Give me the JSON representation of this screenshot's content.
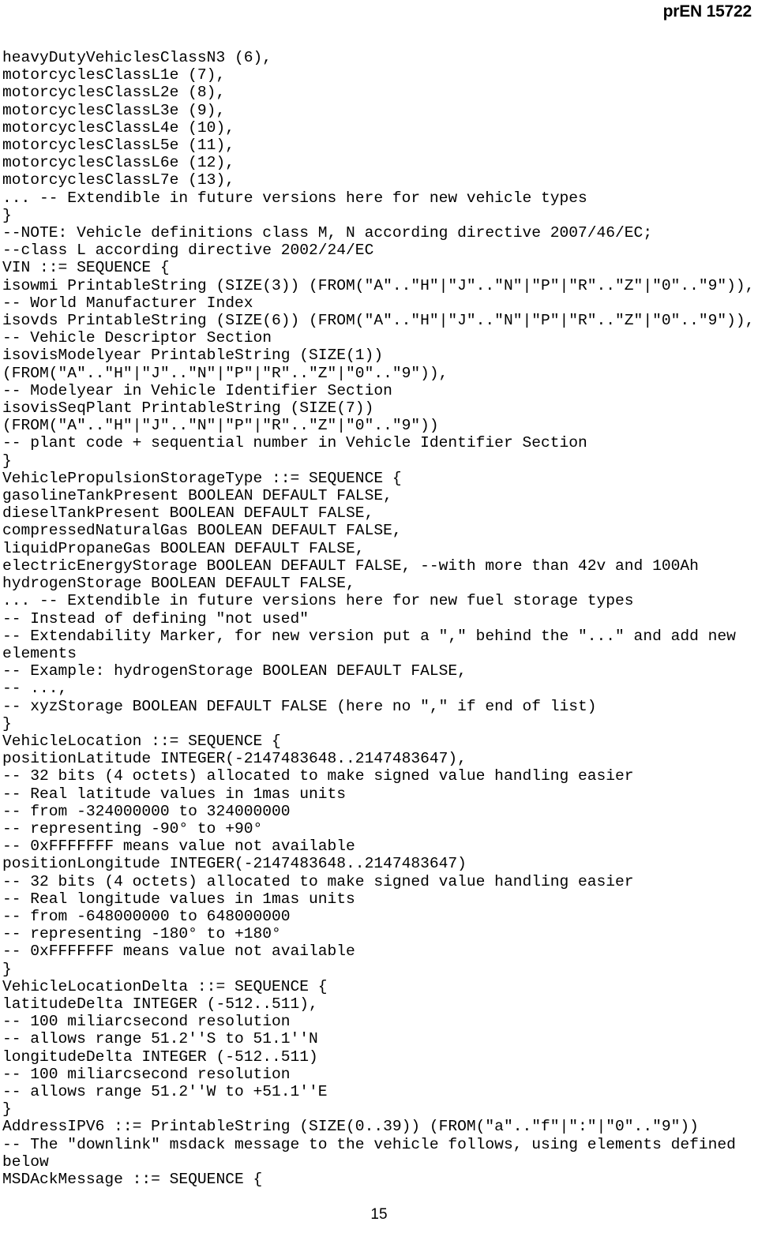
{
  "header": {
    "standard_ref": "prEN 15722"
  },
  "footer": {
    "page_number": "15"
  },
  "code": {
    "language": "ASN.1",
    "lines": [
      "heavyDutyVehiclesClassN3 (6),",
      "motorcyclesClassL1e (7),",
      "motorcyclesClassL2e (8),",
      "motorcyclesClassL3e (9),",
      "motorcyclesClassL4e (10),",
      "motorcyclesClassL5e (11),",
      "motorcyclesClassL6e (12),",
      "motorcyclesClassL7e (13),",
      "... -- Extendible in future versions here for new vehicle types",
      "}",
      "--NOTE: Vehicle definitions class M, N according directive 2007/46/EC;",
      "--class L according directive 2002/24/EC",
      "VIN ::= SEQUENCE {",
      "isowmi PrintableString (SIZE(3)) (FROM(\"A\"..\"H\"|\"J\"..\"N\"|\"P\"|\"R\"..\"Z\"|\"0\"..\"9\")),",
      "-- World Manufacturer Index",
      "isovds PrintableString (SIZE(6)) (FROM(\"A\"..\"H\"|\"J\"..\"N\"|\"P\"|\"R\"..\"Z\"|\"0\"..\"9\")),",
      "-- Vehicle Descriptor Section",
      "isovisModelyear PrintableString (SIZE(1))",
      "(FROM(\"A\"..\"H\"|\"J\"..\"N\"|\"P\"|\"R\"..\"Z\"|\"0\"..\"9\")),",
      "-- Modelyear in Vehicle Identifier Section",
      "isovisSeqPlant PrintableString (SIZE(7))",
      "(FROM(\"A\"..\"H\"|\"J\"..\"N\"|\"P\"|\"R\"..\"Z\"|\"0\"..\"9\"))",
      "-- plant code + sequential number in Vehicle Identifier Section",
      "}",
      "VehiclePropulsionStorageType ::= SEQUENCE {",
      "gasolineTankPresent BOOLEAN DEFAULT FALSE,",
      "dieselTankPresent BOOLEAN DEFAULT FALSE,",
      "compressedNaturalGas BOOLEAN DEFAULT FALSE,",
      "liquidPropaneGas BOOLEAN DEFAULT FALSE,",
      "electricEnergyStorage BOOLEAN DEFAULT FALSE, --with more than 42v and 100Ah",
      "hydrogenStorage BOOLEAN DEFAULT FALSE,",
      "... -- Extendible in future versions here for new fuel storage types",
      "-- Instead of defining \"not used\"",
      "-- Extendability Marker, for new version put a \",\" behind the \"...\" and add new",
      "elements",
      "-- Example: hydrogenStorage BOOLEAN DEFAULT FALSE,",
      "-- ...,",
      "-- xyzStorage BOOLEAN DEFAULT FALSE (here no \",\" if end of list)",
      "}",
      "VehicleLocation ::= SEQUENCE {",
      "positionLatitude INTEGER(-2147483648..2147483647),",
      "-- 32 bits (4 octets) allocated to make signed value handling easier",
      "-- Real latitude values in 1mas units",
      "-- from -324000000 to 324000000",
      "-- representing -90° to +90°",
      "-- 0xFFFFFFF means value not available",
      "positionLongitude INTEGER(-2147483648..2147483647)",
      "-- 32 bits (4 octets) allocated to make signed value handling easier",
      "-- Real longitude values in 1mas units",
      "-- from -648000000 to 648000000",
      "-- representing -180° to +180°",
      "-- 0xFFFFFFF means value not available",
      "}",
      "VehicleLocationDelta ::= SEQUENCE {",
      "latitudeDelta INTEGER (-512..511),",
      "-- 100 miliarcsecond resolution",
      "-- allows range 51.2''S to 51.1''N",
      "longitudeDelta INTEGER (-512..511)",
      "-- 100 miliarcsecond resolution",
      "-- allows range 51.2''W to +51.1''E",
      "}",
      "AddressIPV6 ::= PrintableString (SIZE(0..39)) (FROM(\"a\"..\"f\"|\":\"|\"0\"..\"9\"))",
      "-- The \"downlink\" msdack message to the vehicle follows, using elements defined",
      "below",
      "MSDAckMessage ::= SEQUENCE {"
    ]
  }
}
